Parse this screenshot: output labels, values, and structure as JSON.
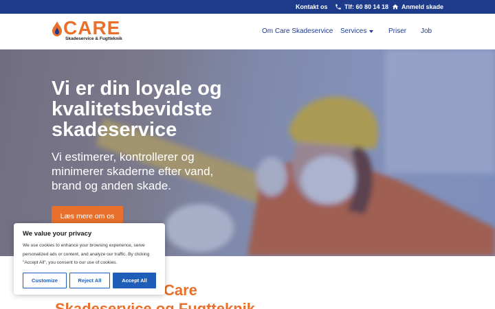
{
  "topbar": {
    "contact": "Kontakt os",
    "phone": "Tlf: 60 80 14 18",
    "report": "Anmeld skade"
  },
  "logo": {
    "word": "CARE",
    "subtitle": "Skadeservice & Fugtteknik"
  },
  "nav": {
    "about": "Om Care Skadeservice",
    "services": "Services",
    "prices": "Priser",
    "job": "Job"
  },
  "hero": {
    "title": "Vi er din loyale og kvalitetsbevidste skadeservice",
    "subtitle": "Vi estimerer, kontrollerer og minimerer skaderne efter vand, brand og anden skade.",
    "button": "Læs mere om os"
  },
  "below": {
    "line1": "Care",
    "line2": "Skadeservice og Fugtteknik"
  },
  "cookie": {
    "title": "We value your privacy",
    "text": "We use cookies to enhance your browsing experience, serve personalized ads or content, and analyze our traffic. By clicking \"Accept All\", you consent to our use of cookies.",
    "customize": "Customize",
    "reject": "Reject All",
    "accept": "Accept All"
  },
  "colors": {
    "brand_blue": "#1e3a8a",
    "brand_orange": "#e8702a",
    "cookie_blue": "#1e5eb8"
  }
}
